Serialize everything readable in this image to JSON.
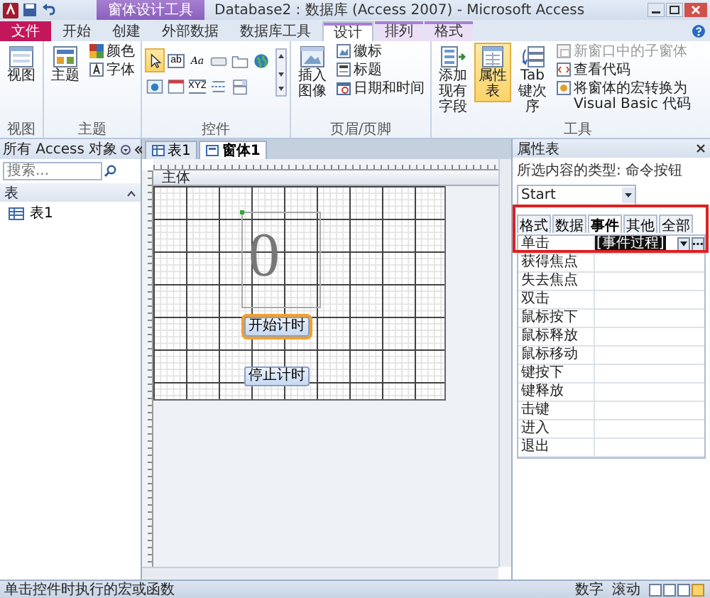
{
  "title_bar": {
    "contextual_tab": "窗体设计工具",
    "title": "Database2 : 数据库 (Access 2007) - Microsoft Access"
  },
  "ribbon_tabs": [
    {
      "label": "文件",
      "kind": "file",
      "selected": false,
      "contextual": false
    },
    {
      "label": "开始",
      "kind": "tab",
      "selected": false,
      "contextual": false
    },
    {
      "label": "创建",
      "kind": "tab",
      "selected": false,
      "contextual": false
    },
    {
      "label": "外部数据",
      "kind": "tab",
      "selected": false,
      "contextual": false
    },
    {
      "label": "数据库工具",
      "kind": "tab",
      "selected": false,
      "contextual": false
    },
    {
      "label": "设计",
      "kind": "tab",
      "selected": true,
      "contextual": true
    },
    {
      "label": "排列",
      "kind": "tab",
      "selected": false,
      "contextual": true
    },
    {
      "label": "格式",
      "kind": "tab",
      "selected": false,
      "contextual": true
    }
  ],
  "ribbon_groups": [
    {
      "label": "视图",
      "kind": "buttons",
      "buttons": [
        {
          "label": "视图",
          "kind": "large",
          "selected": false,
          "disabled": false
        }
      ]
    },
    {
      "label": "主题",
      "kind": "buttons",
      "buttons": [
        {
          "label": "主题",
          "kind": "large",
          "selected": false,
          "disabled": false
        },
        {
          "label": "颜色",
          "kind": "small",
          "selected": false,
          "disabled": false
        },
        {
          "label": "字体",
          "kind": "small",
          "selected": false,
          "disabled": false
        }
      ]
    },
    {
      "label": "控件",
      "kind": "gallery",
      "controls": [
        {
          "kind": "pointer",
          "selected": true
        },
        {
          "kind": "textbox",
          "text": "ab",
          "selected": false
        },
        {
          "kind": "label",
          "text": "Aa",
          "selected": false
        },
        {
          "kind": "button",
          "selected": false
        },
        {
          "kind": "tab",
          "selected": false
        },
        {
          "kind": "hyperlink",
          "selected": false
        },
        {
          "kind": "browser",
          "selected": false
        },
        {
          "kind": "navigation",
          "selected": false
        },
        {
          "kind": "option_group",
          "text": "XYZ",
          "selected": false
        },
        {
          "kind": "page_break",
          "selected": false
        },
        {
          "kind": "combo",
          "selected": false
        }
      ]
    },
    {
      "label": "页眉/页脚",
      "kind": "buttons",
      "buttons": [
        {
          "label": "插入图像",
          "kind": "large",
          "selected": false,
          "disabled": false
        },
        {
          "label": "徽标",
          "kind": "small",
          "selected": false,
          "disabled": false
        },
        {
          "label": "标题",
          "kind": "small",
          "selected": false,
          "disabled": false
        },
        {
          "label": "日期和时间",
          "kind": "small",
          "selected": false,
          "disabled": false
        }
      ]
    },
    {
      "label": "工具",
      "kind": "buttons",
      "buttons": [
        {
          "label": "添加现有字段",
          "kind": "large",
          "selected": false,
          "disabled": false
        },
        {
          "label": "属性表",
          "kind": "large",
          "selected": true,
          "disabled": false
        },
        {
          "label": "Tab 键次序",
          "kind": "large",
          "selected": false,
          "disabled": false
        },
        {
          "label": "新窗口中的子窗体",
          "kind": "small",
          "selected": false,
          "disabled": true
        },
        {
          "label": "查看代码",
          "kind": "small",
          "selected": false,
          "disabled": false
        },
        {
          "label": "将窗体的宏转换为 Visual Basic 代码",
          "kind": "small",
          "selected": false,
          "disabled": false
        }
      ]
    }
  ],
  "nav_pane": {
    "title": "所有 Access 对象",
    "search": {
      "placeholder": "搜索..."
    },
    "groups": [
      {
        "label": "表",
        "expanded": true,
        "items": [
          {
            "label": "表1",
            "selected": false
          }
        ]
      }
    ]
  },
  "document_tabs": [
    {
      "label": "表1",
      "selected": false
    },
    {
      "label": "窗体1",
      "selected": true
    }
  ],
  "form": {
    "section": "主体",
    "label": {
      "text": "0"
    },
    "buttons": [
      {
        "label": "开始计时",
        "selected": true
      },
      {
        "label": "停止计时",
        "selected": false
      }
    ]
  },
  "property_sheet": {
    "title": "属性表",
    "selection_type": "所选内容的类型: 命令按钮",
    "object": "Start",
    "tabs": [
      {
        "label": "格式",
        "selected": false
      },
      {
        "label": "数据",
        "selected": false
      },
      {
        "label": "事件",
        "selected": true
      },
      {
        "label": "其他",
        "selected": false
      },
      {
        "label": "全部",
        "selected": false
      }
    ],
    "rows": [
      {
        "name": "单击",
        "value": "[事件过程]",
        "selected": true
      },
      {
        "name": "获得焦点",
        "selected": false
      },
      {
        "name": "失去焦点",
        "selected": false
      },
      {
        "name": "双击",
        "selected": false
      },
      {
        "name": "鼠标按下",
        "selected": false
      },
      {
        "name": "鼠标释放",
        "selected": false
      },
      {
        "name": "鼠标移动",
        "selected": false
      },
      {
        "name": "键按下",
        "selected": false
      },
      {
        "name": "键释放",
        "selected": false
      },
      {
        "name": "击键",
        "selected": false
      },
      {
        "name": "进入",
        "selected": false
      },
      {
        "name": "退出",
        "selected": false
      }
    ]
  },
  "status_bar": {
    "text": "单击控件时执行的宏或函数",
    "indicators": [
      "数字",
      "滚动"
    ]
  }
}
